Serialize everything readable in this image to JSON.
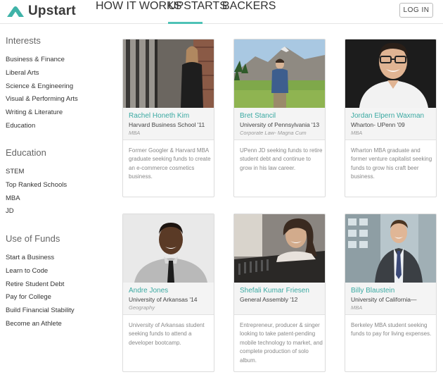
{
  "header": {
    "brand": "Upstart",
    "nav": [
      "HOW IT WORKS",
      "UPSTARTS",
      "BACKERS"
    ],
    "active_nav": "UPSTARTS",
    "login_label": "LOG IN",
    "accent_color": "#4ec2b6"
  },
  "sidebar": {
    "sections": [
      {
        "heading": "Interests",
        "items": [
          "Business & Finance",
          "Liberal Arts",
          "Science & Engineering",
          "Visual & Performing Arts",
          "Writing & Literature",
          "Education"
        ]
      },
      {
        "heading": "Education",
        "items": [
          "STEM",
          "Top Ranked Schools",
          "MBA",
          "JD"
        ]
      },
      {
        "heading": "Use of Funds",
        "items": [
          "Start a Business",
          "Learn to Code",
          "Retire Student Debt",
          "Pay for College",
          "Build Financial Stability",
          "Become an Athlete"
        ]
      }
    ]
  },
  "cards": [
    {
      "name": "Rachel Honeth Kim",
      "school": "Harvard Business School '11",
      "degree": "MBA",
      "desc": "Former Googler & Harvard MBA graduate seeking funds to create an e-commerce cosmetics business.",
      "photo": "woman-standing-by-window"
    },
    {
      "name": "Bret Stancil",
      "school": "University of Pennsylvania '13",
      "degree": "Corporate Law- Magna Cum",
      "desc": "UPenn JD seeking funds to retire student debt and continue to grow in his law career.",
      "photo": "man-in-mountain-meadow"
    },
    {
      "name": "Jordan Elpern Waxman",
      "school": "Wharton- UPenn '09",
      "degree": "MBA",
      "desc": "Wharton MBA graduate and former venture capitalist seeking funds to grow his craft beer business.",
      "photo": "smiling-man-with-glasses"
    },
    {
      "name": "Andre Jones",
      "school": "University of Arkansas '14",
      "degree": "Geography",
      "desc": "University of Arkansas student seeking funds to attend a developer bootcamp.",
      "photo": "man-in-shirt-and-tie"
    },
    {
      "name": "Shefali Kumar Friesen",
      "school": "General Assembly '12",
      "degree": "",
      "desc": "Entrepreneur, producer & singer looking to take patent-pending mobile technology to market, and complete production of solo album.",
      "photo": "woman-at-mixing-console"
    },
    {
      "name": "Billy Blaustein",
      "school": "University of California—",
      "degree": "MBA",
      "desc": "Berkeley MBA student seeking funds to pay for living expenses.",
      "photo": "man-in-suit-office"
    }
  ]
}
